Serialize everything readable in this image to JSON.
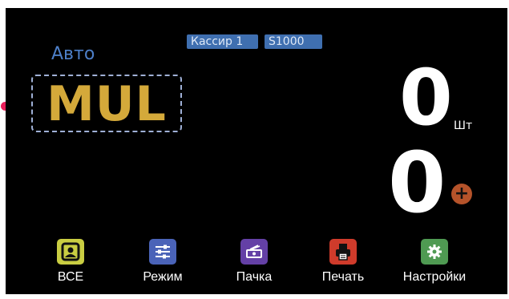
{
  "header": {
    "cashier_label": "Кассир 1",
    "model_label": "S1000"
  },
  "mode": "Авто",
  "currency_mode": "MUL",
  "counters": {
    "count": "0",
    "count_unit": "Шт",
    "amount": "0",
    "add_symbol": "+"
  },
  "toolbar": {
    "all": "ВСЕ",
    "mode": "Режим",
    "batch": "Пачка",
    "print": "Печать",
    "settings": "Настройки"
  },
  "colors": {
    "background": "#000000",
    "accent_blue": "#3f6fb0",
    "mode_text": "#4d7fc8",
    "currency_text": "#d4a93a",
    "all_button": "#c9cd42",
    "mode_button": "#4a63b8",
    "batch_button": "#6440a6",
    "print_button": "#cf3b2b",
    "settings_button": "#4f9a52",
    "add_button": "#b5532a",
    "indicator_dot": "#e91e5a"
  }
}
